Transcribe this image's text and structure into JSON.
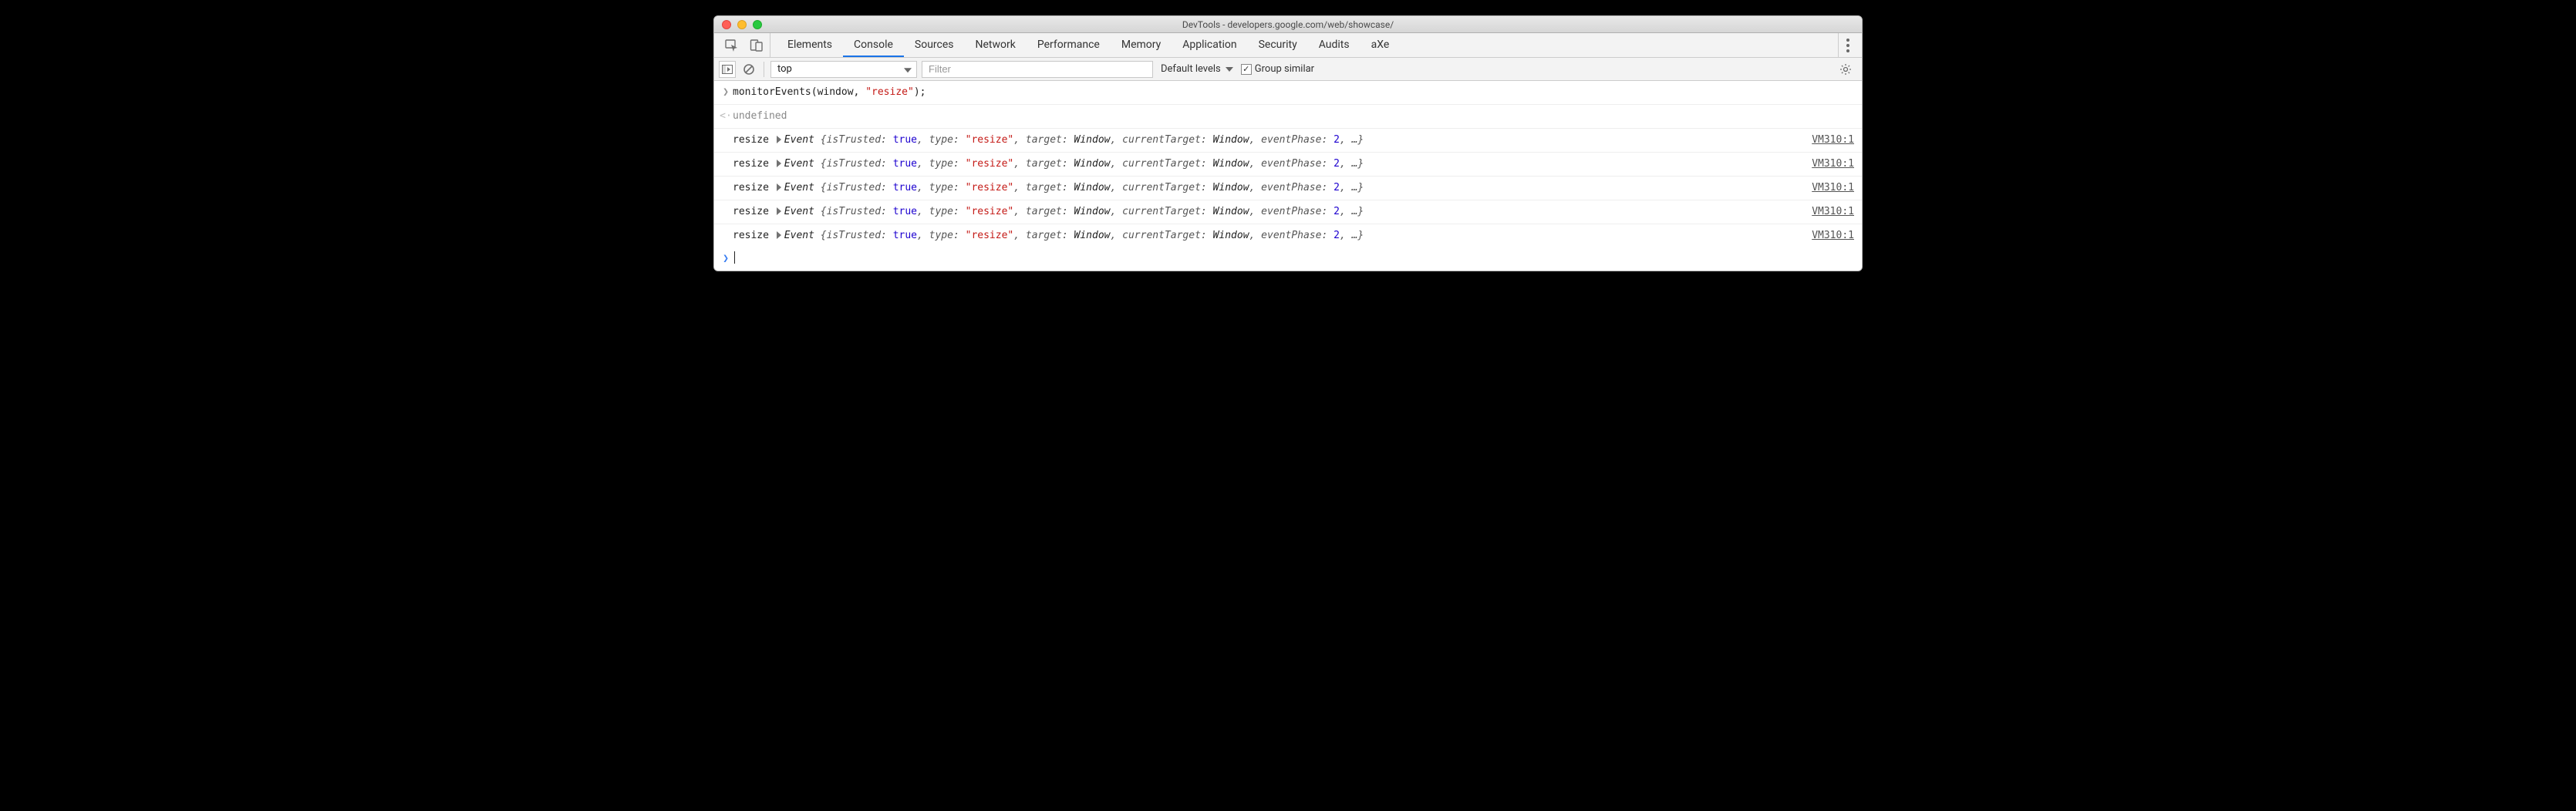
{
  "window": {
    "title": "DevTools - developers.google.com/web/showcase/"
  },
  "tabs": {
    "items": [
      "Elements",
      "Console",
      "Sources",
      "Network",
      "Performance",
      "Memory",
      "Application",
      "Security",
      "Audits",
      "aXe"
    ],
    "active": "Console"
  },
  "toolbar": {
    "context": "top",
    "filter_placeholder": "Filter",
    "levels_label": "Default levels",
    "group_similar_label": "Group similar",
    "group_similar_checked": true
  },
  "console": {
    "input_line": {
      "func": "monitorEvents",
      "args_prefix": "(window, ",
      "args_string": "\"resize\"",
      "args_suffix": ");"
    },
    "return_line": "undefined",
    "events": [
      {
        "name": "resize",
        "source": "VM310:1",
        "isTrusted": "true",
        "type": "\"resize\"",
        "target": "Window",
        "currentTarget": "Window",
        "eventPhase": "2"
      },
      {
        "name": "resize",
        "source": "VM310:1",
        "isTrusted": "true",
        "type": "\"resize\"",
        "target": "Window",
        "currentTarget": "Window",
        "eventPhase": "2"
      },
      {
        "name": "resize",
        "source": "VM310:1",
        "isTrusted": "true",
        "type": "\"resize\"",
        "target": "Window",
        "currentTarget": "Window",
        "eventPhase": "2"
      },
      {
        "name": "resize",
        "source": "VM310:1",
        "isTrusted": "true",
        "type": "\"resize\"",
        "target": "Window",
        "currentTarget": "Window",
        "eventPhase": "2"
      },
      {
        "name": "resize",
        "source": "VM310:1",
        "isTrusted": "true",
        "type": "\"resize\"",
        "target": "Window",
        "currentTarget": "Window",
        "eventPhase": "2"
      }
    ]
  }
}
